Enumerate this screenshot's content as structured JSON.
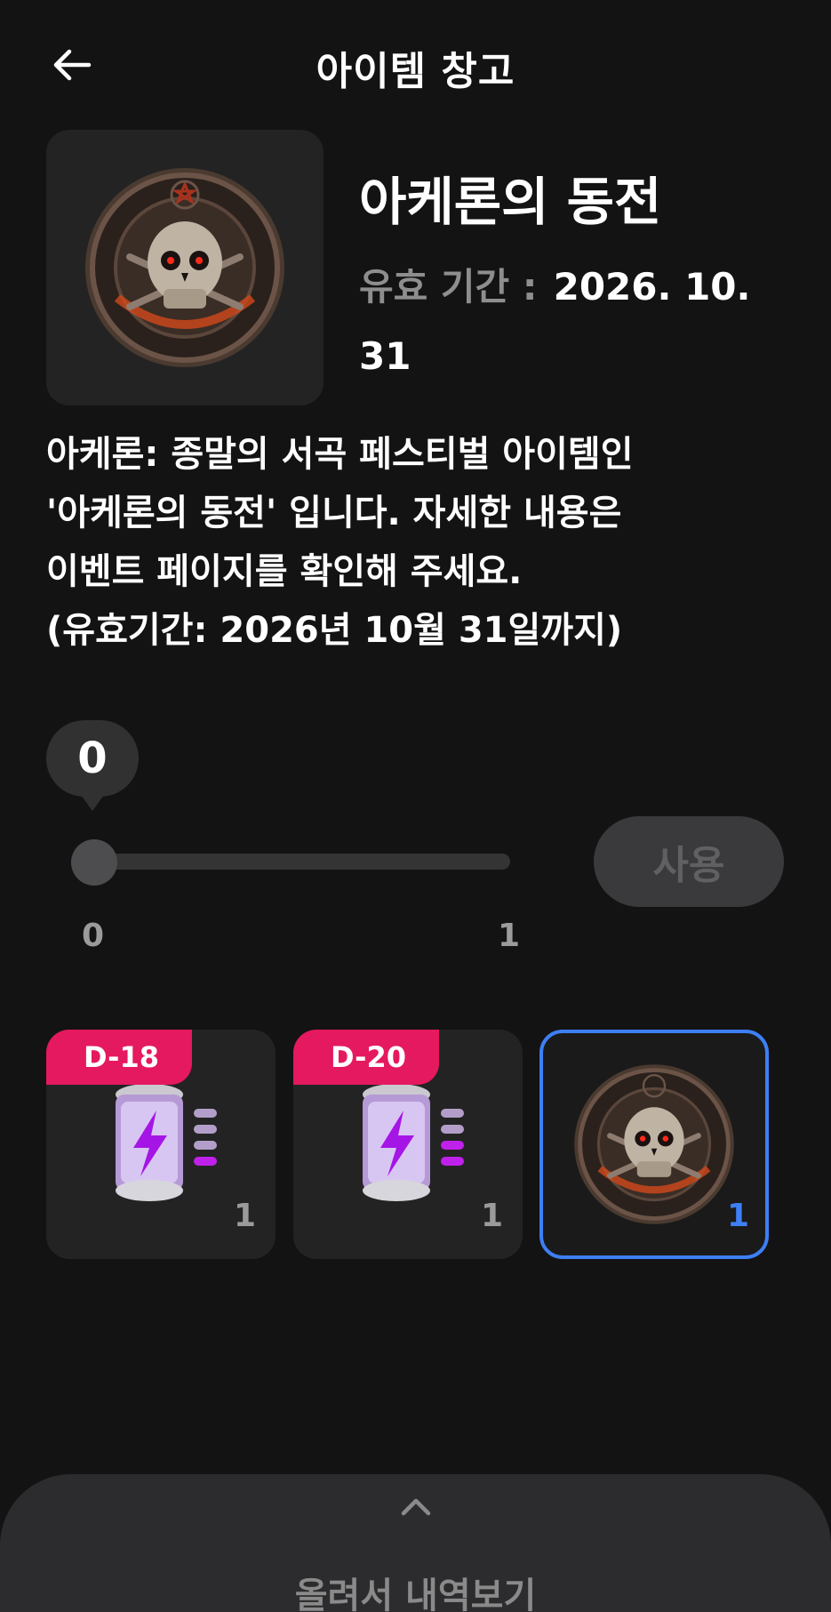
{
  "header": {
    "title": "아이템 창고"
  },
  "item": {
    "name": "아케론의 동전",
    "expiry_label": "유효 기간 :",
    "expiry_value": "2026. 10. 31",
    "description": "아케론: 종말의 서곡 페스티벌 아이템인\n'아케론의 동전' 입니다. 자세한 내용은\n이벤트 페이지를 확인해 주세요.\n(유효기간: 2026년 10월 31일까지)"
  },
  "slider": {
    "current": "0",
    "min": "0",
    "max": "1",
    "value_fraction": 0
  },
  "use_button": {
    "label": "사용"
  },
  "inventory": [
    {
      "tag": "D-18",
      "count": "1",
      "icon": "energy-battery-icon",
      "selected": false
    },
    {
      "tag": "D-20",
      "count": "1",
      "icon": "energy-battery-icon",
      "selected": false
    },
    {
      "tag": "",
      "count": "1",
      "icon": "skull-coin-icon",
      "selected": true
    }
  ],
  "bottom_sheet": {
    "label": "올려서 내역보기"
  },
  "colors": {
    "accent": "#3d7ff5",
    "tag": "#e5195f",
    "background": "#131313",
    "card": "#232323"
  }
}
